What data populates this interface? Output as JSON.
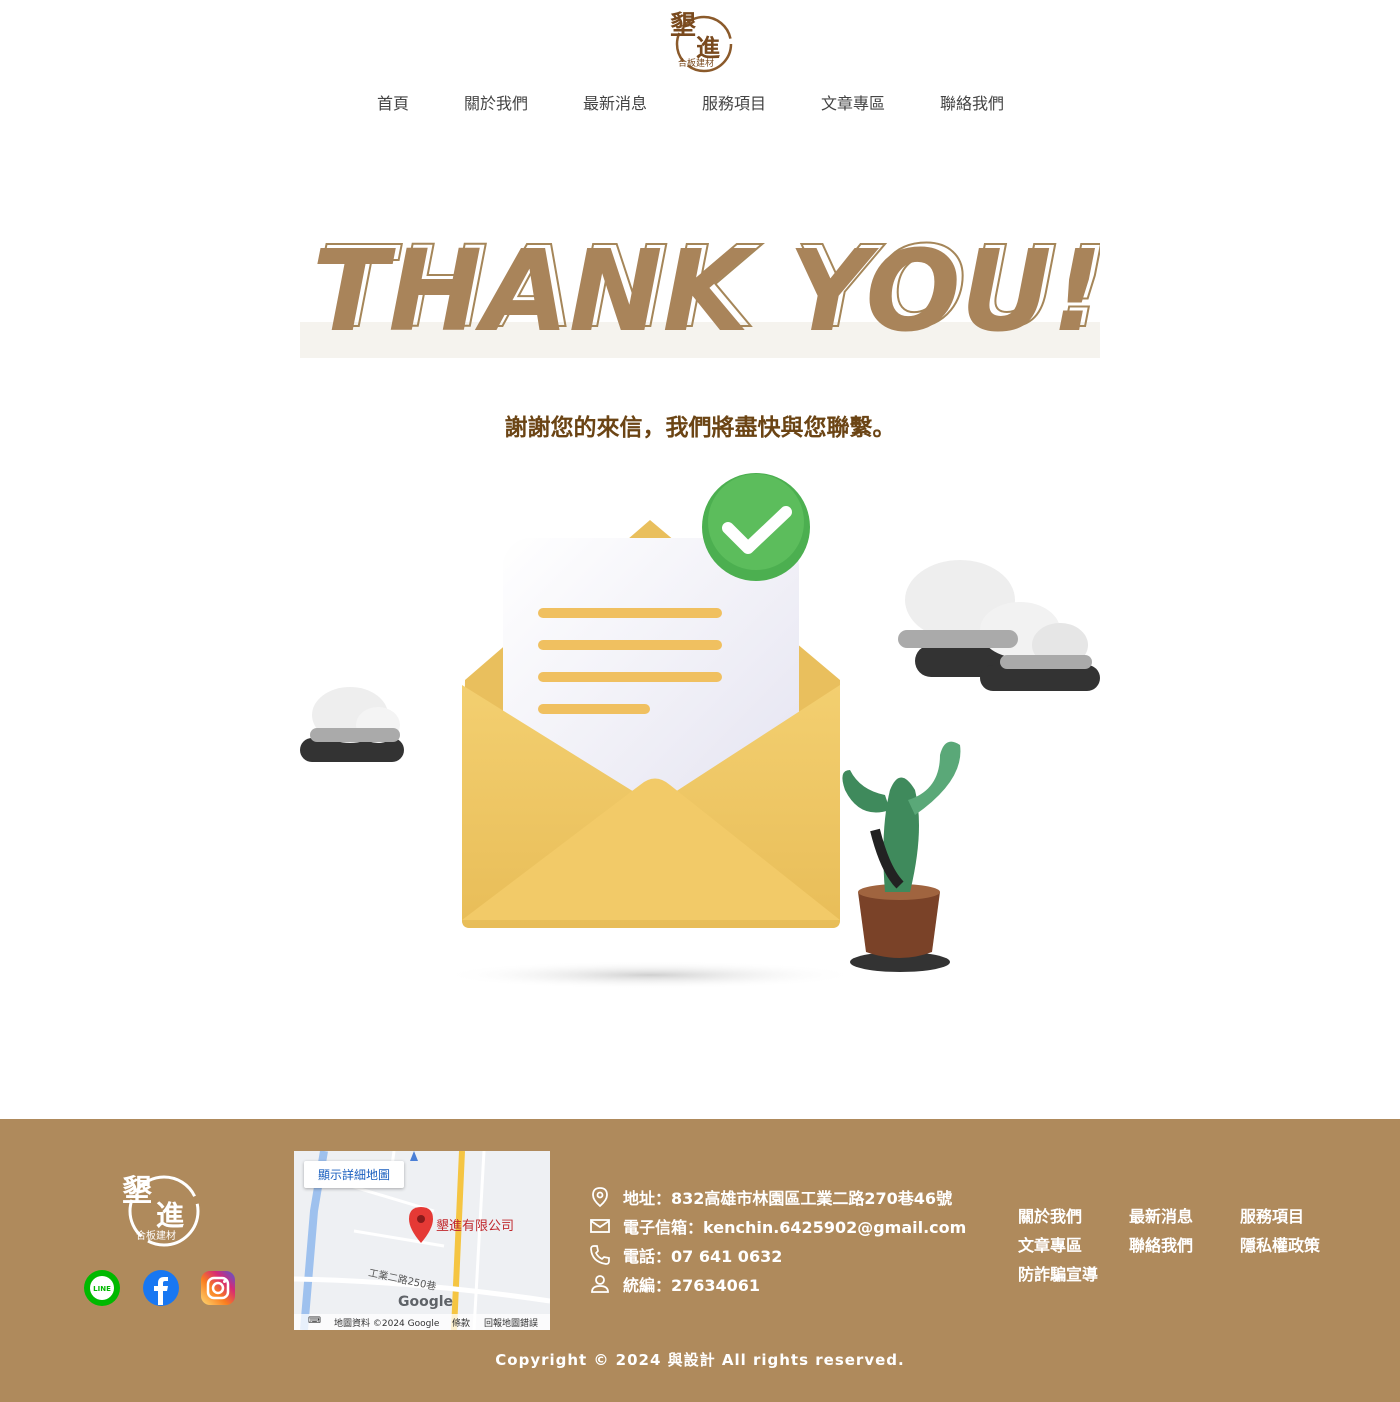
{
  "brand": {
    "logo_top_main": "墾",
    "logo_top_sub": "進",
    "logo_small": "合板建材"
  },
  "nav": {
    "items": [
      {
        "label": "首頁"
      },
      {
        "label": "關於我們"
      },
      {
        "label": "最新消息"
      },
      {
        "label": "服務項目"
      },
      {
        "label": "文章專區"
      },
      {
        "label": "聯絡我們"
      }
    ]
  },
  "hero": {
    "banner_text": "THANK YOU!",
    "message": "謝謝您的來信，我們將盡快與您聯繫。"
  },
  "footer": {
    "social": [
      {
        "name": "line-icon",
        "label": "LINE"
      },
      {
        "name": "facebook-icon"
      },
      {
        "name": "instagram-icon"
      }
    ],
    "map": {
      "button": "顯示詳細地圖",
      "pin_label": "墾進有限公司",
      "road_label": "工業二路250巷",
      "google": "Google",
      "attribution": "地圖資料 ©2024 Google",
      "terms": "條款",
      "report": "回報地圖錯誤"
    },
    "contact": [
      {
        "icon": "map-pin-icon",
        "text": "地址：832高雄市林園區工業二路270巷46號"
      },
      {
        "icon": "mail-icon",
        "text": "電子信箱：kenchin.6425902@gmail.com"
      },
      {
        "icon": "phone-icon",
        "text": "電話：07 641 0632"
      },
      {
        "icon": "user-icon",
        "text": "統編：27634061"
      }
    ],
    "links": [
      {
        "label": "關於我們"
      },
      {
        "label": "最新消息"
      },
      {
        "label": "服務項目"
      },
      {
        "label": "文章專區"
      },
      {
        "label": "聯絡我們"
      },
      {
        "label": "隱私權政策"
      },
      {
        "label": "防詐騙宣導"
      }
    ],
    "copyright": "Copyright © 2024 與設計 All rights reserved."
  },
  "colors": {
    "brand_brown": "#af8a5c",
    "text_brown": "#6b4414",
    "envelope": "#efc86a",
    "check_green": "#4caf50"
  }
}
